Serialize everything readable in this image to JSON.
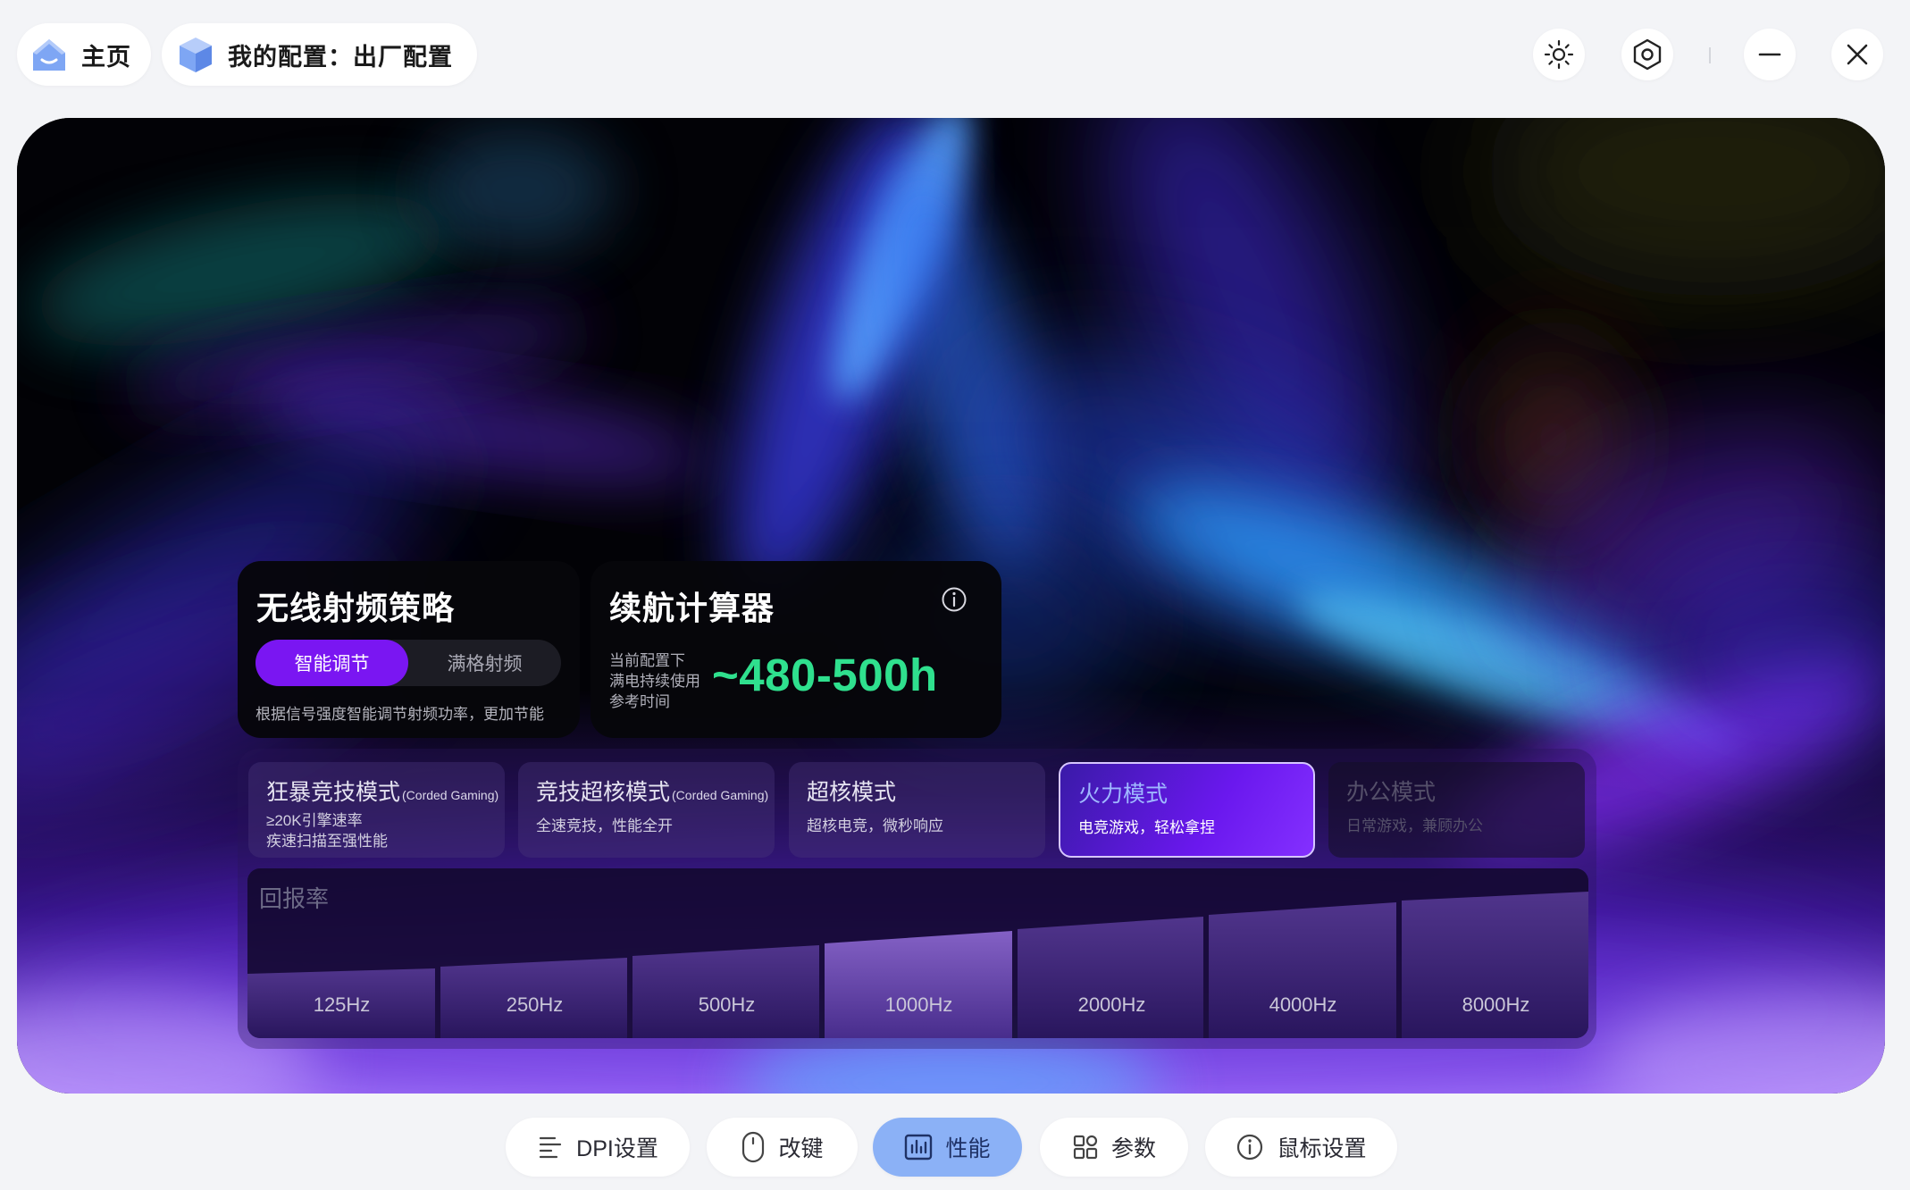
{
  "header": {
    "home_label": "主页",
    "config_label": "我的配置：出厂配置"
  },
  "window_controls": [
    "theme-icon",
    "settings-icon",
    "minimize-icon",
    "close-icon"
  ],
  "rf_card": {
    "title": "无线射频策略",
    "options": [
      "智能调节",
      "满格射频"
    ],
    "selected": "智能调节",
    "description": "根据信号强度智能调节射频功率，更加节能"
  },
  "battery_card": {
    "title": "续航计算器",
    "lines": [
      "当前配置下",
      "满电持续使用",
      "参考时间"
    ],
    "value": "~480-500h"
  },
  "modes": [
    {
      "name": "狂暴竞技模式",
      "tag": "(Corded Gaming)",
      "line1": "≥20K引擎速率",
      "line2": "疾速扫描至强性能",
      "state": "normal"
    },
    {
      "name": "竞技超核模式",
      "tag": "(Corded Gaming)",
      "line1": "全速竞技，性能全开",
      "line2": "",
      "state": "normal"
    },
    {
      "name": "超核模式",
      "tag": "",
      "line1": "超核电竞，微秒响应",
      "line2": "",
      "state": "normal"
    },
    {
      "name": "火力模式",
      "tag": "",
      "line1": "电竞游戏，轻松拿捏",
      "line2": "",
      "state": "active"
    },
    {
      "name": "办公模式",
      "tag": "",
      "line1": "日常游戏，兼顾办公",
      "line2": "",
      "state": "disabled"
    }
  ],
  "polling_rate": {
    "title": "回报率",
    "options": [
      "125Hz",
      "250Hz",
      "500Hz",
      "1000Hz",
      "2000Hz",
      "4000Hz",
      "8000Hz"
    ],
    "selected": "1000Hz"
  },
  "bottom_nav": [
    {
      "label": "DPI设置",
      "icon": "dpi-icon"
    },
    {
      "label": "改键",
      "icon": "mouse-icon"
    },
    {
      "label": "性能",
      "icon": "performance-icon",
      "active": true
    },
    {
      "label": "参数",
      "icon": "grid-icon"
    },
    {
      "label": "鼠标设置",
      "icon": "info-icon"
    }
  ],
  "colors": {
    "accent": "#7a16f2",
    "battery_value": "#2fe08e",
    "nav_active": "#8bb1f6"
  }
}
